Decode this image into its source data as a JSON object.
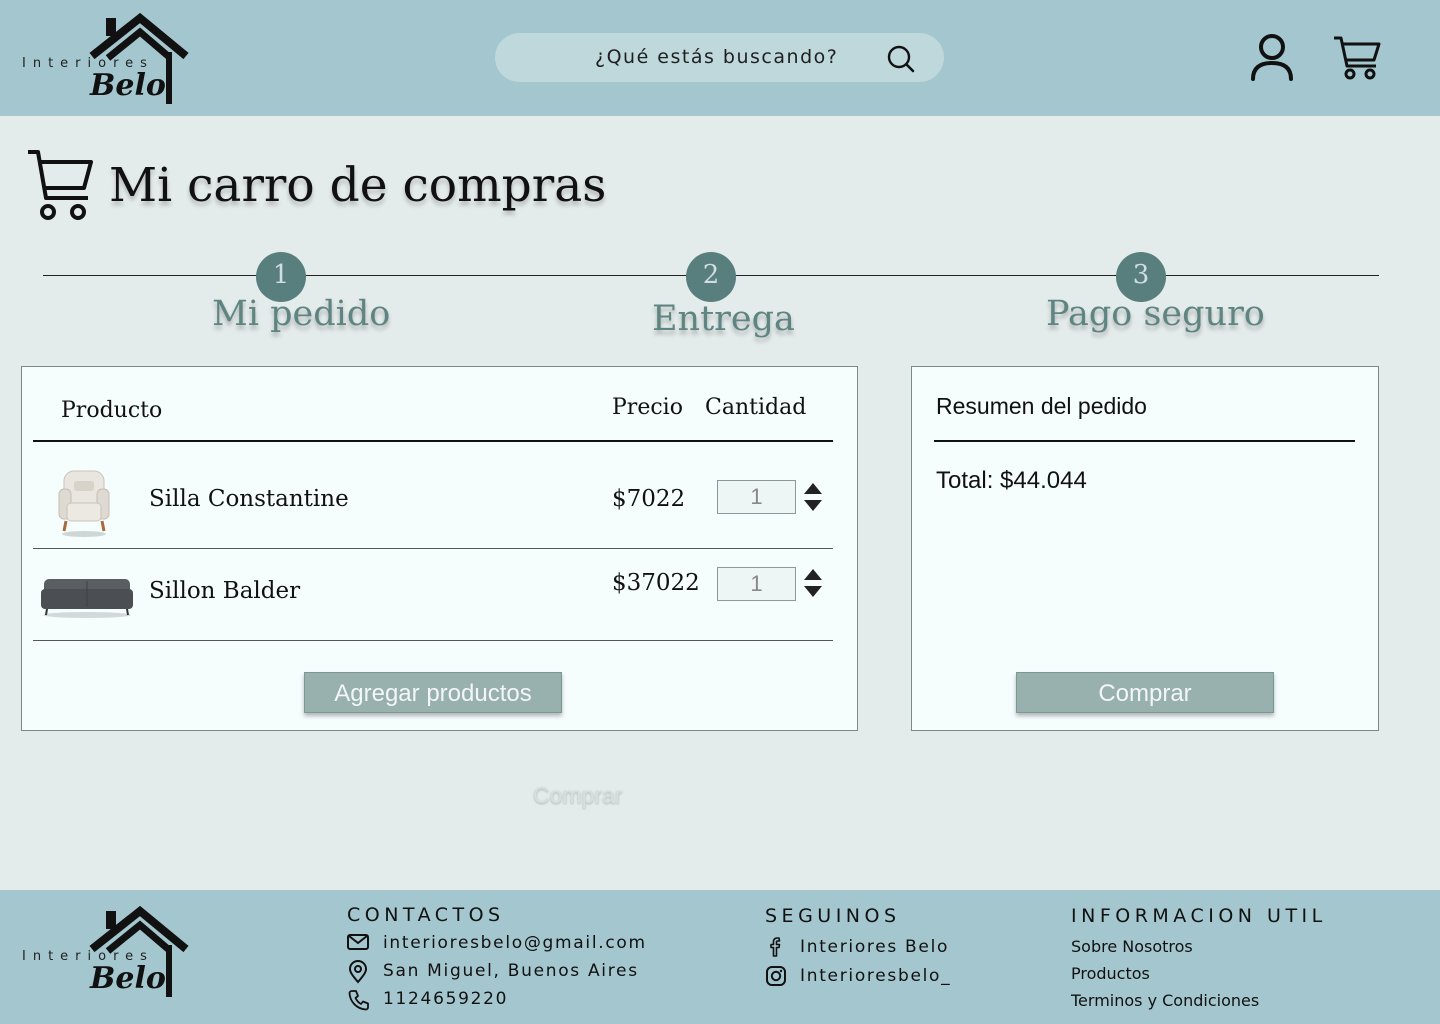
{
  "brand": {
    "logo_top": "Interiores",
    "logo_bottom": "Belo"
  },
  "header": {
    "search_placeholder": "¿Qué estás buscando?",
    "icons": [
      "search-icon",
      "user-icon",
      "cart-icon"
    ]
  },
  "page": {
    "title": "Mi carro de compras"
  },
  "steps": [
    {
      "number": "1",
      "label": "Mi pedido"
    },
    {
      "number": "2",
      "label": "Entrega"
    },
    {
      "number": "3",
      "label": "Pago seguro"
    }
  ],
  "cart": {
    "columns": {
      "product": "Producto",
      "price": "Precio",
      "quantity": "Cantidad"
    },
    "items": [
      {
        "name": "Silla Constantine",
        "price": "$7022",
        "quantity": "1",
        "image": "armchair-image"
      },
      {
        "name": "Sillon Balder",
        "price": "$37022",
        "quantity": "1",
        "image": "sofa-image"
      }
    ],
    "add_button": "Agregar productos"
  },
  "summary": {
    "title": "Resumen del pedido",
    "total": "Total: $44.044",
    "buy_button": "Comprar"
  },
  "ghost_label": "Comprar",
  "footer": {
    "contacts": {
      "heading": "CONTACTOS",
      "email": "interioresbelo@gmail.com",
      "address": "San Miguel, Buenos Aires",
      "phone": "1124659220"
    },
    "social": {
      "heading": "SEGUINOS",
      "facebook": "Interiores Belo",
      "instagram": "Interioresbelo_"
    },
    "info": {
      "heading": "INFORMACION UTIL",
      "links": [
        "Sobre Nosotros",
        "Productos",
        "Terminos y Condiciones"
      ]
    }
  },
  "colors": {
    "header_bg": "#a4c6cf",
    "page_bg": "#e4ebeb",
    "accent": "#587e7e",
    "button_bg": "#98b0ae"
  }
}
